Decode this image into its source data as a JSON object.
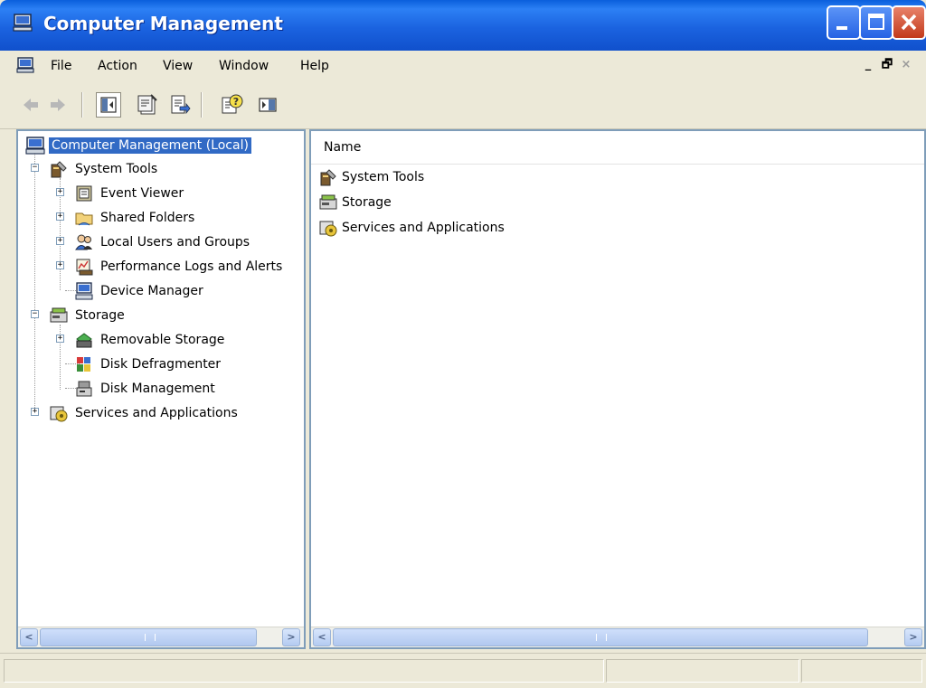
{
  "window": {
    "title": "Computer Management",
    "controls": [
      "minimize",
      "maximize",
      "close"
    ]
  },
  "menubar": {
    "items": [
      "File",
      "Action",
      "View",
      "Window",
      "Help"
    ],
    "mdi_controls": [
      "_",
      "🗗",
      "×"
    ]
  },
  "toolbar": {
    "buttons": [
      "back-icon",
      "forward-icon",
      "show-hide-console-tree-icon",
      "properties-icon",
      "export-list-icon",
      "help-icon",
      "show-hide-action-pane-icon"
    ]
  },
  "tree": {
    "root": "Computer Management (Local)",
    "system_tools": "System Tools",
    "event_viewer": "Event Viewer",
    "shared_folders": "Shared Folders",
    "local_users": "Local Users and Groups",
    "perf_logs": "Performance Logs and Alerts",
    "device_manager": "Device Manager",
    "storage": "Storage",
    "removable_storage": "Removable Storage",
    "disk_defrag": "Disk Defragmenter",
    "disk_management": "Disk Management",
    "services_apps": "Services and Applications"
  },
  "list": {
    "column_header": "Name",
    "items": [
      "System Tools",
      "Storage",
      "Services and Applications"
    ]
  },
  "colors": {
    "title_bar": "#1b63e0",
    "selection": "#316ac5",
    "chrome": "#ece9d8"
  }
}
